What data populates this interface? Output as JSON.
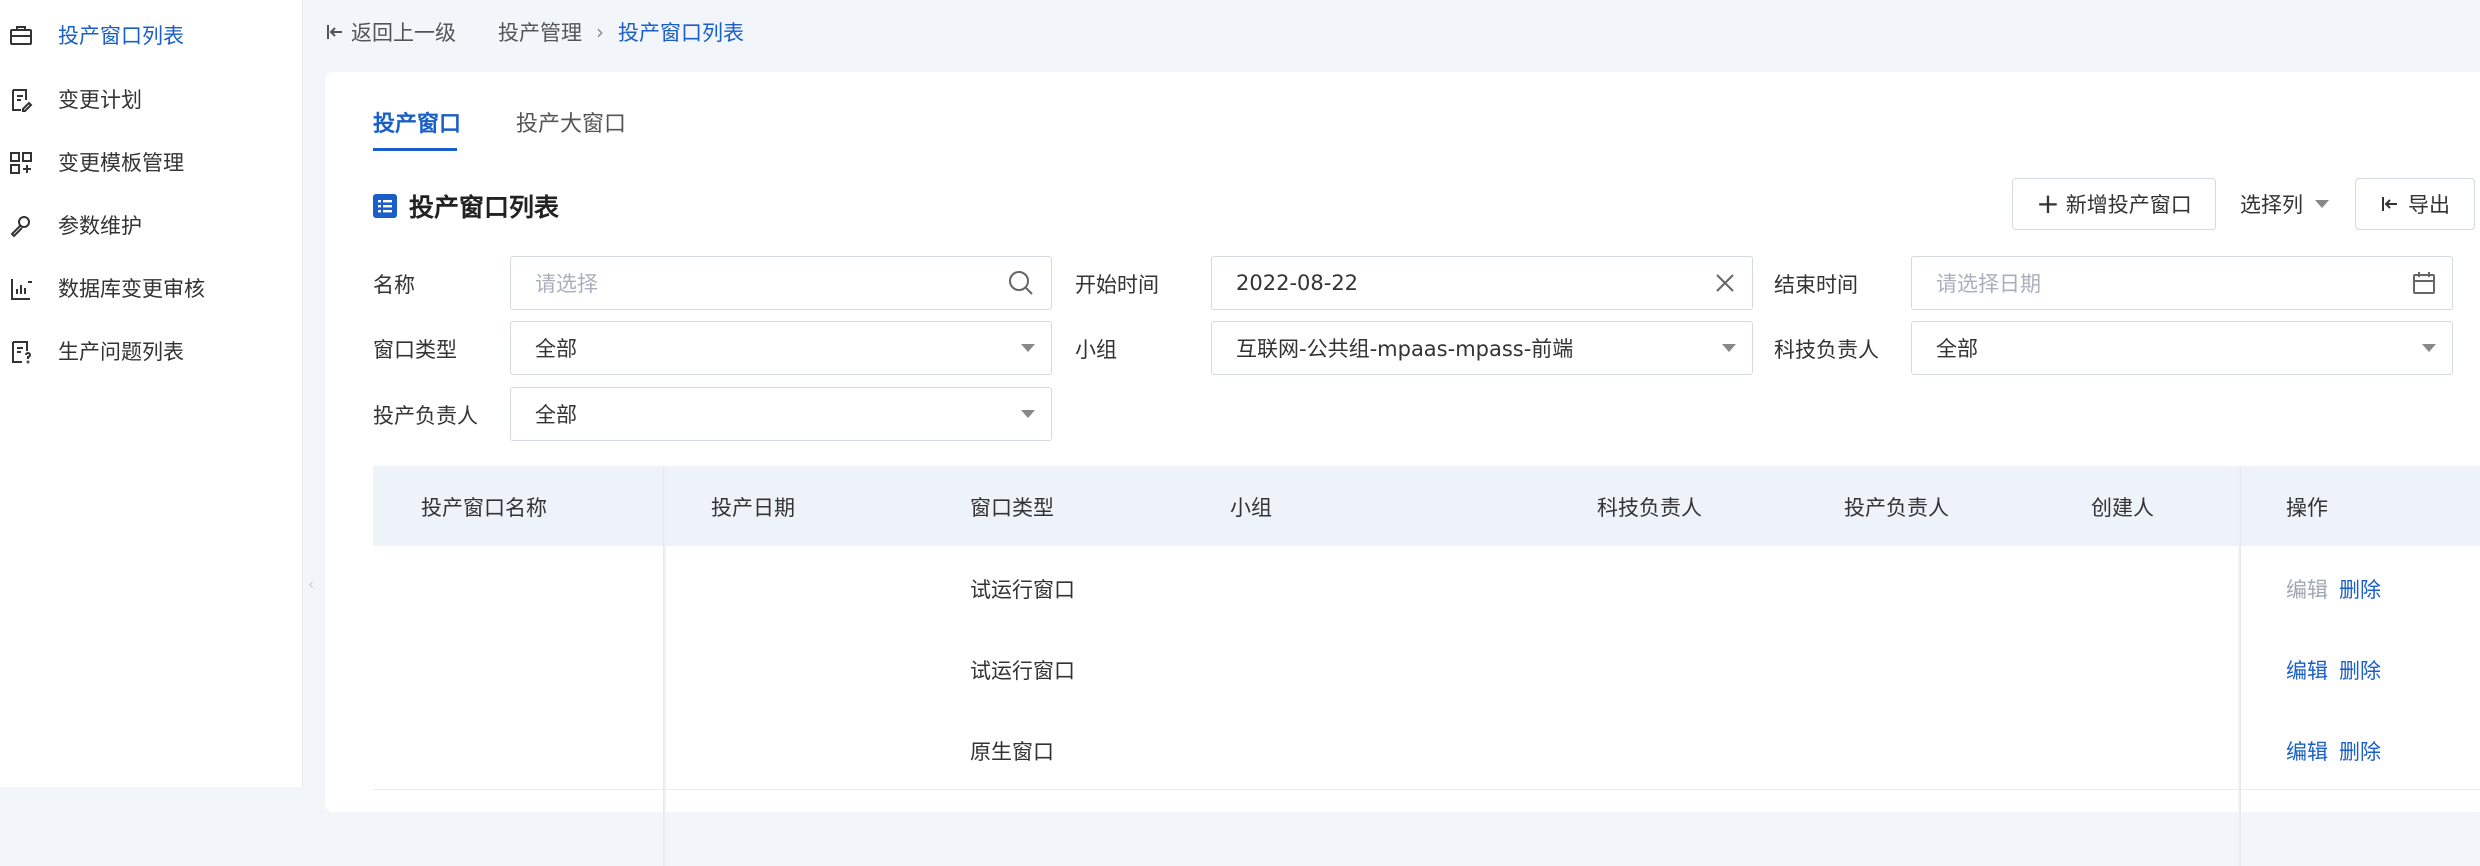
{
  "sidebar": {
    "items": [
      {
        "label": "投产窗口列表",
        "icon": "briefcase-icon",
        "active": true
      },
      {
        "label": "变更计划",
        "icon": "document-edit-icon",
        "active": false
      },
      {
        "label": "变更模板管理",
        "icon": "template-blocks-icon",
        "active": false
      },
      {
        "label": "参数维护",
        "icon": "wrench-icon",
        "active": false
      },
      {
        "label": "数据库变更审核",
        "icon": "database-chart-icon",
        "active": false
      },
      {
        "label": "生产问题列表",
        "icon": "document-question-icon",
        "active": false
      }
    ],
    "collapse_glyph": "‹"
  },
  "breadcrumb": {
    "back_label": "返回上一级",
    "level1": "投产管理",
    "current": "投产窗口列表"
  },
  "tabs": [
    {
      "label": "投产窗口",
      "active": true
    },
    {
      "label": "投产大窗口",
      "active": false
    }
  ],
  "section": {
    "title": "投产窗口列表"
  },
  "toolbar": {
    "add_label": "新增投产窗口",
    "select_columns_label": "选择列",
    "export_label": "导出"
  },
  "filters": {
    "name_label": "名称",
    "name_placeholder": "请选择",
    "start_label": "开始时间",
    "start_value": "2022-08-22",
    "end_label": "结束时间",
    "end_placeholder": "请选择日期",
    "window_type_label": "窗口类型",
    "window_type_value": "全部",
    "group_label": "小组",
    "group_value": "互联网-公共组-mpaas-mpass-前端",
    "tech_owner_label": "科技负责人",
    "tech_owner_value": "全部",
    "deploy_owner_label": "投产负责人",
    "deploy_owner_value": "全部"
  },
  "table": {
    "columns": [
      "投产窗口名称",
      "投产日期",
      "窗口类型",
      "小组",
      "科技负责人",
      "投产负责人",
      "创建人",
      "操作"
    ],
    "rows": [
      {
        "name": "",
        "date": "",
        "type": "试运行窗口",
        "group": "",
        "tech_owner": "",
        "deploy_owner": "",
        "creator": "",
        "edit": "编辑",
        "delete": "删除",
        "edit_disabled": true
      },
      {
        "name": "",
        "date": "",
        "type": "试运行窗口",
        "group": "",
        "tech_owner": "",
        "deploy_owner": "",
        "creator": "",
        "edit": "编辑",
        "delete": "删除",
        "edit_disabled": false
      },
      {
        "name": "",
        "date": "",
        "type": "原生窗口",
        "group": "",
        "tech_owner": "",
        "deploy_owner": "",
        "creator": "",
        "edit": "编辑",
        "delete": "删除",
        "edit_disabled": false
      }
    ]
  },
  "colors": {
    "accent": "#1a5fc9",
    "header_bg": "#eef2f9",
    "page_bg": "#f2f5fa"
  }
}
